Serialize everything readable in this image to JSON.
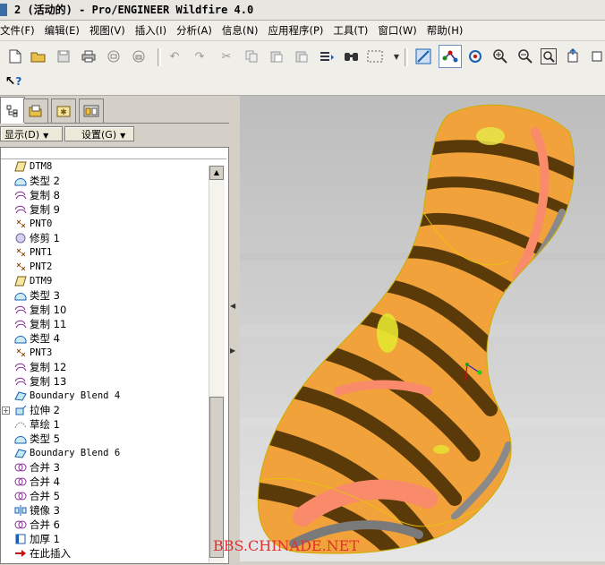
{
  "window": {
    "title": "2 (活动的) - Pro/ENGINEER Wildfire 4.0"
  },
  "menubar": {
    "items": [
      "文件(F)",
      "编辑(E)",
      "视图(V)",
      "插入(I)",
      "分析(A)",
      "信息(N)",
      "应用程序(P)",
      "工具(T)",
      "窗口(W)",
      "帮助(H)"
    ]
  },
  "toolbar": {
    "icons": [
      "new-file-icon",
      "open-folder-icon",
      "save-icon",
      "print-icon",
      "send-mail-icon",
      "mail-recipient-icon",
      "undo-icon",
      "redo-icon",
      "cut-icon",
      "copy-icon",
      "paste-icon",
      "paste-special-icon",
      "regenerate-icon",
      "find-icon",
      "select-box-icon",
      "repaint-icon",
      "spin-center-icon",
      "orient-mode-icon",
      "zoom-in-icon",
      "zoom-out-icon",
      "refit-icon",
      "saved-view-icon",
      "whats-this-icon"
    ]
  },
  "navigator": {
    "tabs": [
      "model-tree-icon",
      "folder-browser-icon",
      "favorites-icon",
      "connections-icon"
    ],
    "show_button": "显示(D)",
    "settings_button": "设置(G)",
    "rows": [
      {
        "label": "DTM8",
        "icon": "datum-plane-icon"
      },
      {
        "label": "类型 2",
        "icon": "surface-icon"
      },
      {
        "label": "复制 8",
        "icon": "copy-surface-icon"
      },
      {
        "label": "复制 9",
        "icon": "copy-surface-icon"
      },
      {
        "label": "PNT0",
        "icon": "datum-point-icon"
      },
      {
        "label": "修剪 1",
        "icon": "trim-icon"
      },
      {
        "label": "PNT1",
        "icon": "datum-point-icon"
      },
      {
        "label": "PNT2",
        "icon": "datum-point-icon"
      },
      {
        "label": "DTM9",
        "icon": "datum-plane-icon"
      },
      {
        "label": "类型 3",
        "icon": "surface-icon"
      },
      {
        "label": "复制 10",
        "icon": "copy-surface-icon"
      },
      {
        "label": "复制 11",
        "icon": "copy-surface-icon"
      },
      {
        "label": "类型 4",
        "icon": "surface-icon"
      },
      {
        "label": "PNT3",
        "icon": "datum-point-icon"
      },
      {
        "label": "复制 12",
        "icon": "copy-surface-icon"
      },
      {
        "label": "复制 13",
        "icon": "copy-surface-icon"
      },
      {
        "label": "Boundary Blend 4",
        "icon": "boundary-blend-icon"
      },
      {
        "label": "拉伸 2",
        "icon": "extrude-icon",
        "expandable": true
      },
      {
        "label": "草绘 1",
        "icon": "sketch-icon"
      },
      {
        "label": "类型 5",
        "icon": "surface-icon"
      },
      {
        "label": "Boundary Blend 6",
        "icon": "boundary-blend-icon"
      },
      {
        "label": "合并 3",
        "icon": "merge-icon"
      },
      {
        "label": "合并 4",
        "icon": "merge-icon"
      },
      {
        "label": "合并 5",
        "icon": "merge-icon"
      },
      {
        "label": "镜像 3",
        "icon": "mirror-icon"
      },
      {
        "label": "合并 6",
        "icon": "merge-icon"
      },
      {
        "label": "加厚 1",
        "icon": "thicken-icon"
      },
      {
        "label": "在此插入",
        "icon": "insert-here-arrow-icon"
      }
    ]
  },
  "watermark": "BBS.CHINADE.NET",
  "colors": {
    "zebra_light": "#f2a23a",
    "zebra_dark": "#5a3a08",
    "zebra_pink": "#f98a6a",
    "viewport_bg_top": "#bebebe",
    "viewport_bg_bottom": "#e4e4e4",
    "accent_blue": "#3a6ea5"
  }
}
